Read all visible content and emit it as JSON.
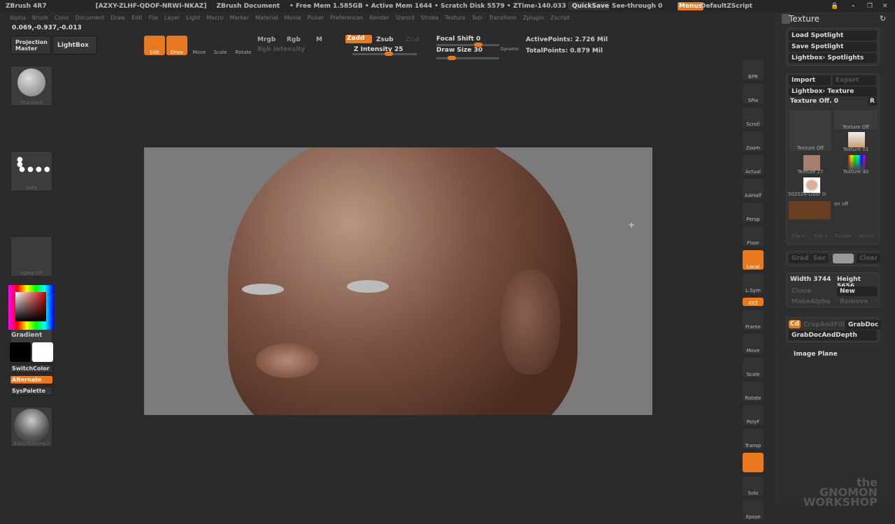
{
  "titlebar": {
    "app": "ZBrush 4R7",
    "serial": "[AZXY-ZLHF-QDOF-NRWI-NKAZ]",
    "doc": "ZBrush Document",
    "stats": "• Free Mem 1.585GB • Active Mem 1644 • Scratch Disk 5579 • ZTime›140.033 Ti",
    "quicksave": "QuickSave",
    "seethrough": "See-through  0",
    "menus": "Menus",
    "script": "DefaultZScript"
  },
  "menus": [
    "Alpha",
    "Brush",
    "Color",
    "Document",
    "Draw",
    "Edit",
    "File",
    "Layer",
    "Light",
    "Macro",
    "Marker",
    "Material",
    "Movie",
    "Picker",
    "Preferences",
    "Render",
    "Stencil",
    "Stroke",
    "Texture",
    "Tool",
    "Transform",
    "Zplugin",
    "Zscript"
  ],
  "coords": "0.069,-0.937,-0.013",
  "toolbar": {
    "projection_master": "Projection Master",
    "lightbox": "LightBox",
    "edit": "Edit",
    "draw": "Draw",
    "move": "Move",
    "scale": "Scale",
    "rotate": "Rotate",
    "mrgb": "Mrgb",
    "rgb": "Rgb",
    "m": "M",
    "rgb_intensity": "Rgb Intensity",
    "zadd": "Zadd",
    "zsub": "Zsub",
    "zcut": "Zcut",
    "z_intensity": "Z Intensity 25",
    "focal_shift": "Focal Shift 0",
    "draw_size": "Draw Size 30",
    "dynamic": "Dynamic",
    "active_points": "ActivePoints: 2.726  Mil",
    "total_points": "TotalPoints: 0.879  Mil"
  },
  "slider_values": {
    "focal_shift": 0,
    "z_intensity": 25,
    "draw_size": 30,
    "see_through": 0
  },
  "left_shelf": {
    "brush": "Standard",
    "stroke": "Dots",
    "alpha": "Alpha Off",
    "texture": "Texture Off",
    "material": "BasicMaterial2",
    "gradient": "Gradient",
    "switchcolor": "SwitchColor",
    "alternate": "Alternate",
    "syspalette": "SysPalette"
  },
  "right_shelf": [
    "BPR",
    "SPix",
    "Scroll",
    "Zoom",
    "Actual",
    "AAHalf",
    "Persp",
    "Floor",
    "Local",
    "L.Sym",
    "XYZ",
    "Frame",
    "Move",
    "Scale",
    "Rotate",
    "PolyF",
    "Transp",
    "",
    "Solo",
    "Xpose"
  ],
  "texture_panel": {
    "title": "Texture",
    "load": "Load Spotlight",
    "save": "Save Spotlight",
    "lightbox_spot": "Lightbox› Spotlights",
    "import": "Import",
    "export": "Export",
    "lightbox_tex": "Lightbox› Texture",
    "texture_off": "Texture Off. 0",
    "r": "R",
    "thumbs": [
      "Texture Off",
      "Texture Off",
      "Texture 01",
      "Texture 27",
      "Texture 40",
      "502024-Libor 0:"
    ],
    "onoff": "on off",
    "flip_h": "Flip H",
    "flip_v": "Flip V",
    "rotate": "Rotate",
    "invers": "Invers",
    "grad": "Grad",
    "sec": "Sec",
    "main": "Main",
    "clear": "Clear",
    "width": "Width 3744",
    "height": "Height 5656",
    "clone": "Clone",
    "new": "New",
    "makealpha": "MakeAlpha",
    "remove": "Remove",
    "cd": "Cd",
    "cropandfill": "CropAndFill",
    "grabdoc": "GrabDoc",
    "grabdocdepth": "GrabDocAndDepth",
    "image_plane": "Image Plane"
  },
  "watermark": "the GNOMON WORKSHOP",
  "colors": {
    "accent": "#e9791f",
    "bg": "#2b2b2b",
    "canvas": "#7b7b7b"
  }
}
